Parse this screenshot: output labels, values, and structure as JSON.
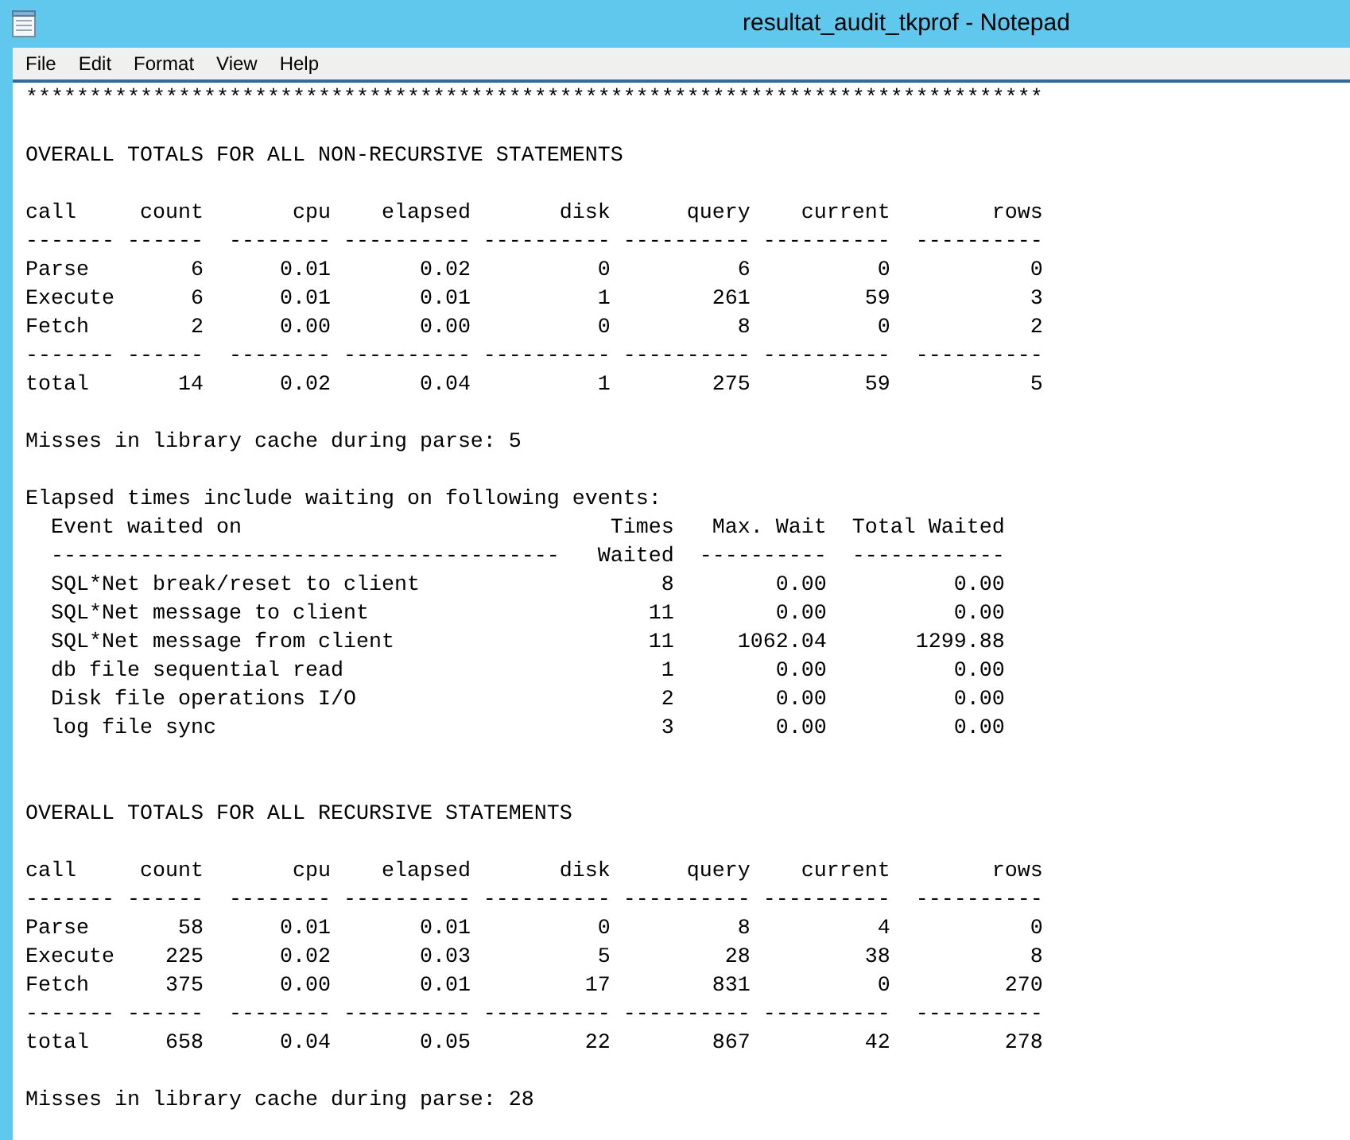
{
  "window": {
    "title": "resultat_audit_tkprof - Notepad"
  },
  "menu": [
    "File",
    "Edit",
    "Format",
    "View",
    "Help"
  ],
  "lines": [
    {
      "kind": "text",
      "text": "********************************************************************************"
    },
    {
      "kind": "blank"
    },
    {
      "kind": "text",
      "text": "OVERALL TOTALS FOR ALL NON-RECURSIVE STATEMENTS"
    },
    {
      "kind": "blank"
    },
    {
      "kind": "text",
      "text": "call     count       cpu    elapsed       disk      query    current        rows"
    },
    {
      "kind": "text",
      "text": "------- ------  -------- ---------- ---------- ---------- ----------  ----------"
    },
    {
      "kind": "text",
      "text": "Parse        6      0.01       0.02          0          6          0           0"
    },
    {
      "kind": "text",
      "text": "Execute      6      0.01       0.01          1        261         59           3"
    },
    {
      "kind": "text",
      "text": "Fetch        2      0.00       0.00          0          8          0           2"
    },
    {
      "kind": "text",
      "text": "------- ------  -------- ---------- ---------- ---------- ----------  ----------"
    },
    {
      "kind": "text",
      "text": "total       14      0.02       0.04          1        275         59           5"
    },
    {
      "kind": "blank"
    },
    {
      "kind": "text",
      "text": "Misses in library cache during parse: 5"
    },
    {
      "kind": "blank"
    },
    {
      "kind": "text",
      "text": "Elapsed times include waiting on following events:"
    },
    {
      "kind": "text",
      "text": "  Event waited on                             Times   Max. Wait  Total Waited"
    },
    {
      "kind": "text",
      "text": "  ----------------------------------------   Waited  ----------  ------------"
    },
    {
      "kind": "text",
      "text": "  SQL*Net break/reset to client                   8        0.00          0.00"
    },
    {
      "kind": "text",
      "text": "  SQL*Net message to client                      11        0.00          0.00"
    },
    {
      "kind": "text",
      "text": "  SQL*Net message from client                    11     1062.04       1299.88"
    },
    {
      "kind": "text",
      "text": "  db file sequential read                         1        0.00          0.00"
    },
    {
      "kind": "text",
      "text": "  Disk file operations I/O                        2        0.00          0.00"
    },
    {
      "kind": "text",
      "text": "  log file sync                                   3        0.00          0.00"
    },
    {
      "kind": "blank"
    },
    {
      "kind": "blank"
    },
    {
      "kind": "text",
      "text": "OVERALL TOTALS FOR ALL RECURSIVE STATEMENTS"
    },
    {
      "kind": "blank"
    },
    {
      "kind": "text",
      "text": "call     count       cpu    elapsed       disk      query    current        rows"
    },
    {
      "kind": "text",
      "text": "------- ------  -------- ---------- ---------- ---------- ----------  ----------"
    },
    {
      "kind": "text",
      "text": "Parse       58      0.01       0.01          0          8          4           0"
    },
    {
      "kind": "text",
      "text": "Execute    225      0.02       0.03          5         28         38           8"
    },
    {
      "kind": "text",
      "text": "Fetch      375      0.00       0.01         17        831          0         270"
    },
    {
      "kind": "text",
      "text": "------- ------  -------- ---------- ---------- ---------- ----------  ----------"
    },
    {
      "kind": "text",
      "text": "total      658      0.04       0.05         22        867         42         278"
    },
    {
      "kind": "blank"
    },
    {
      "kind": "text",
      "text": "Misses in library cache during parse: 28"
    }
  ]
}
